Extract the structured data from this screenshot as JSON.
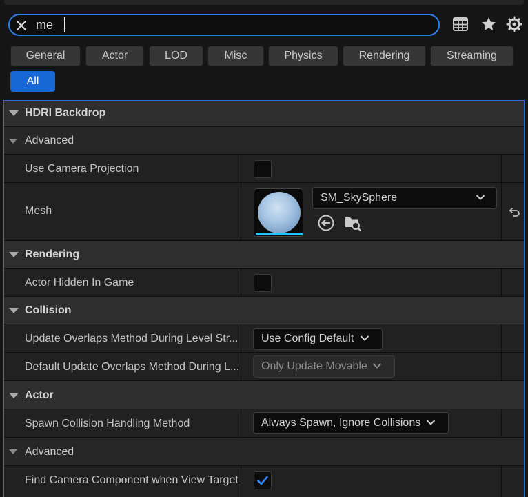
{
  "search": {
    "value": "me"
  },
  "toolbar": {
    "icons": [
      "table-view-icon",
      "star-icon",
      "settings-gear-icon"
    ]
  },
  "filters": [
    "General",
    "Actor",
    "LOD",
    "Misc",
    "Physics",
    "Rendering",
    "Streaming",
    "All"
  ],
  "filters_active": "All",
  "sections": {
    "hdri": {
      "title": "HDRI Backdrop",
      "advanced": "Advanced",
      "use_camera_projection": {
        "label": "Use Camera Projection",
        "checked": false
      },
      "mesh": {
        "label": "Mesh",
        "value": "SM_SkySphere"
      }
    },
    "rendering": {
      "title": "Rendering",
      "actor_hidden": {
        "label": "Actor Hidden In Game",
        "checked": false
      }
    },
    "collision": {
      "title": "Collision",
      "update_overlaps": {
        "label": "Update Overlaps Method During Level Str...",
        "value": "Use Config Default"
      },
      "default_update_overlaps": {
        "label": "Default Update Overlaps Method During L...",
        "value": "Only Update Movable"
      }
    },
    "actor": {
      "title": "Actor",
      "spawn_collision": {
        "label": "Spawn Collision Handling Method",
        "value": "Always Spawn, Ignore Collisions"
      },
      "advanced": "Advanced",
      "find_camera": {
        "label": "Find Camera Component when View Target",
        "checked": true
      }
    }
  },
  "colors": {
    "accent": "#1768d6",
    "focus_border": "#2b7de9",
    "checkmark": "#2f8cff"
  }
}
